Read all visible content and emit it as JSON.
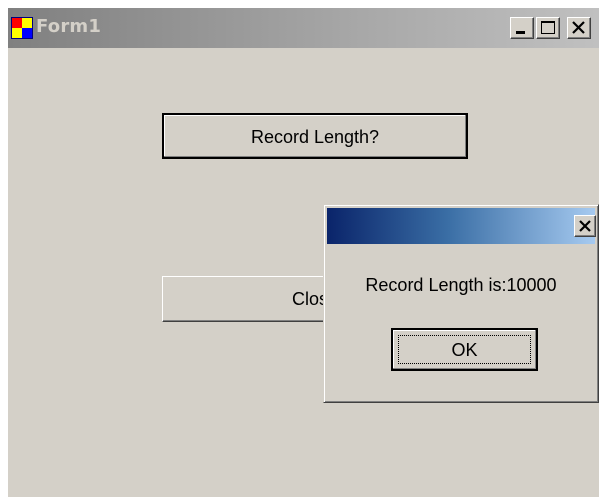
{
  "window": {
    "title": "Form1",
    "icon": "form-app-icon",
    "controls": {
      "minimize": "minimize-icon",
      "maximize": "maximize-icon",
      "close": "close-icon"
    }
  },
  "form": {
    "record_button_label": "Record Length?",
    "close_button_label": "Close"
  },
  "message_box": {
    "title": "",
    "message": "Record Length is:10000",
    "ok_label": "OK",
    "close_icon": "close-icon"
  },
  "colors": {
    "window_face": "#d4d0c8",
    "inactive_title_start": "#808080",
    "active_title_start": "#0a246a",
    "active_title_end": "#a6caf0"
  }
}
